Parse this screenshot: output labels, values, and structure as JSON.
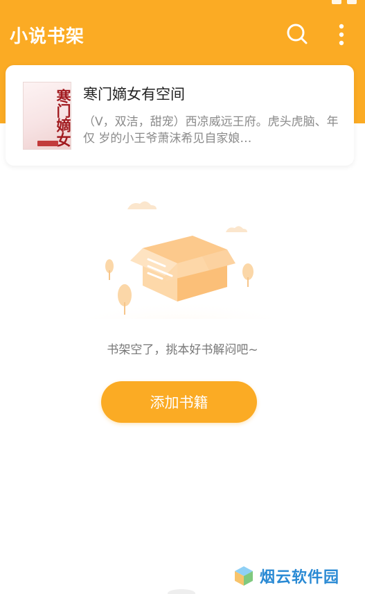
{
  "header": {
    "title": "小说书架",
    "search_icon": "search-icon",
    "more_icon": "more-vertical-icon",
    "bg_color": "#fbab24"
  },
  "book": {
    "title": "寒门嫡女有空间",
    "description": "（V，双洁，甜宠）西凉威远王府。虎头虎脑、年仅 岁的小王爷萧沫希见自家娘…",
    "cover_text": "寒门嫡女"
  },
  "empty_state": {
    "illustration_icon": "empty-box-icon",
    "message": "书架空了，挑本好书解闷吧~"
  },
  "actions": {
    "add_book_label": "添加书籍"
  },
  "watermark": {
    "text": "烟云软件园",
    "icon": "cube-logo-icon"
  },
  "colors": {
    "accent": "#fbab24",
    "text_primary": "#222222",
    "text_secondary": "#8a8a8a"
  }
}
